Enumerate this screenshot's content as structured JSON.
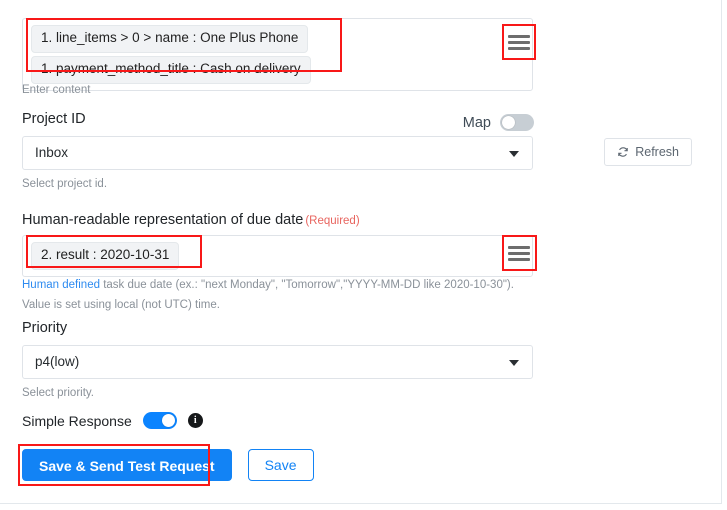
{
  "content_field": {
    "chips": [
      "1. line_items > 0 > name : One Plus Phone",
      "1. payment_method_title : Cash on delivery"
    ],
    "help": "Enter content",
    "handle_icon": "hamburger-drag-handle-icon"
  },
  "project_field": {
    "label": "Project ID",
    "value": "Inbox",
    "help": "Select project id.",
    "map_label": "Map",
    "map_toggle_state": "off",
    "refresh_label": "Refresh",
    "refresh_icon": "refresh-icon",
    "caret_icon": "chevron-down-icon"
  },
  "due_date_field": {
    "label": "Human-readable representation of due date",
    "required_label": "(Required)",
    "chips": [
      "2. result : 2020-10-31"
    ],
    "help_link": "Human defined",
    "help_text": " task due date (ex.: \"next Monday\", \"Tomorrow\",\"YYYY-MM-DD like 2020-10-30\"). Value is set using local (not UTC) time.",
    "handle_icon": "hamburger-drag-handle-icon"
  },
  "priority_field": {
    "label": "Priority",
    "value": "p4(low)",
    "help": "Select priority.",
    "caret_icon": "chevron-down-icon"
  },
  "simple_response": {
    "label": "Simple Response",
    "toggle_state": "on",
    "info_icon": "info-icon",
    "info_glyph": "i"
  },
  "actions": {
    "primary_label": "Save & Send Test Request",
    "secondary_label": "Save"
  },
  "colors": {
    "accent_blue": "#1283f5",
    "toggle_on": "#0b84ff",
    "required_red": "#e8655f",
    "annotation_red": "#f81818",
    "link_blue": "#2e8bf0",
    "chip_bg": "#f1f3f5"
  }
}
